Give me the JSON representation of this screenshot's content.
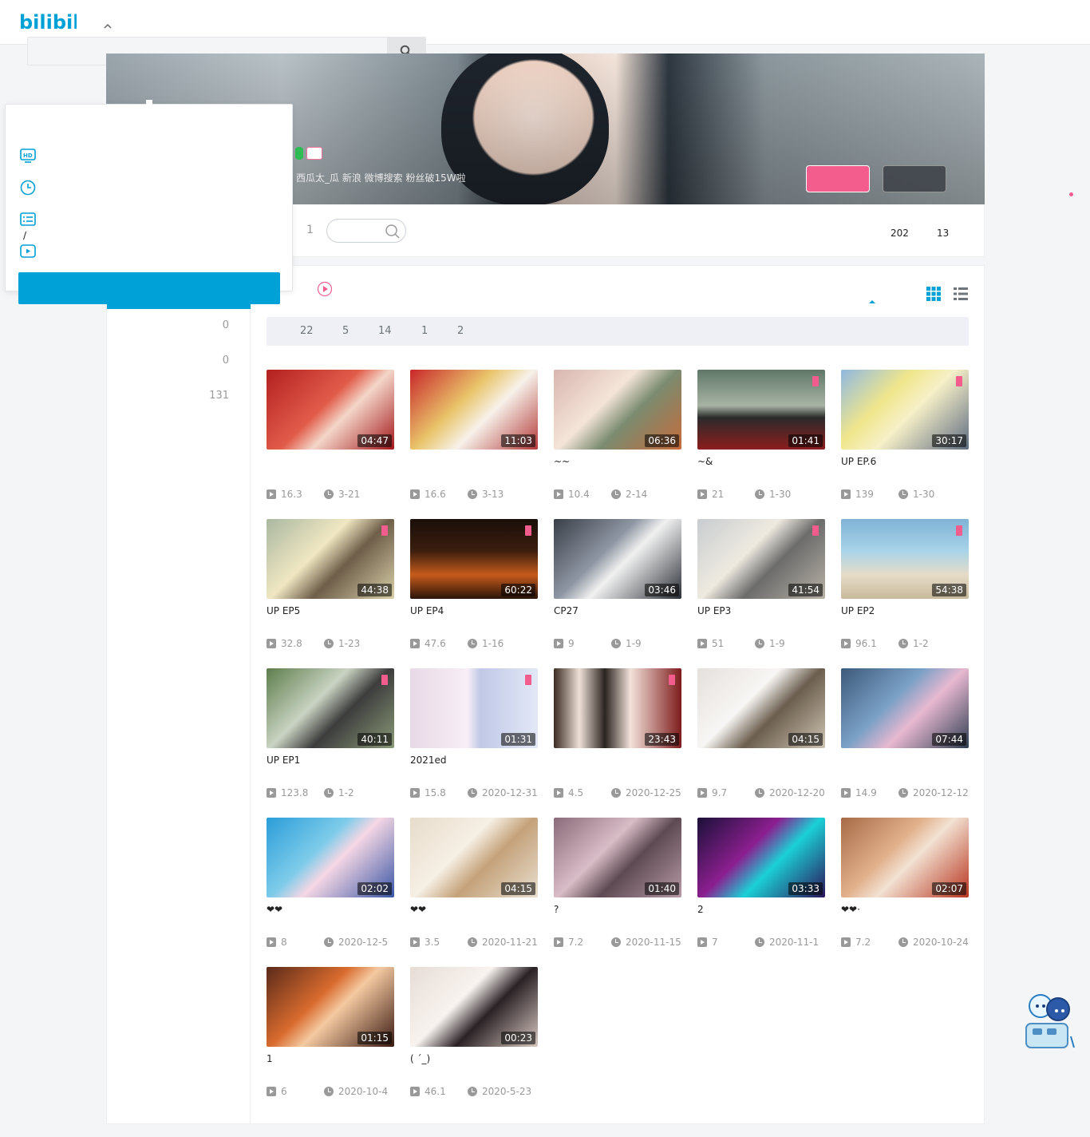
{
  "header": {
    "logo_text": "bilibili",
    "search_placeholder": ""
  },
  "banner": {
    "signature": "西瓜太_瓜 新浪 微博搜索 粉丝破15W啦",
    "follow_label": "",
    "message_label": ""
  },
  "nav": {
    "count": "1",
    "following": "202",
    "fans": "13"
  },
  "sidebar": {
    "counts": [
      "0",
      "0",
      "131"
    ]
  },
  "filters": {
    "counts": [
      "22",
      "5",
      "14",
      "1",
      "2"
    ]
  },
  "popup": {
    "slash": "/",
    "icons": [
      "hd-icon",
      "clock-icon",
      "list-icon",
      "video-icon"
    ]
  },
  "videos": [
    {
      "title": "",
      "duration": "04:47",
      "plays": "16.3",
      "date": "3-21",
      "pinned": false
    },
    {
      "title": "",
      "duration": "11:03",
      "plays": "16.6",
      "date": "3-13",
      "pinned": false
    },
    {
      "title": "~~",
      "duration": "06:36",
      "plays": "10.4",
      "date": "2-14",
      "pinned": false
    },
    {
      "title": "~&",
      "duration": "01:41",
      "plays": "21",
      "date": "1-30",
      "pinned": true
    },
    {
      "title": "UP EP.6",
      "duration": "30:17",
      "plays": "139",
      "date": "1-30",
      "pinned": true
    },
    {
      "title": "UP EP5",
      "duration": "44:38",
      "plays": "32.8",
      "date": "1-23",
      "pinned": true
    },
    {
      "title": "UP EP4",
      "duration": "60:22",
      "plays": "47.6",
      "date": "1-16",
      "pinned": true
    },
    {
      "title": "CP27",
      "duration": "03:46",
      "plays": "9",
      "date": "1-9",
      "pinned": false
    },
    {
      "title": "UP EP3",
      "duration": "41:54",
      "plays": "51",
      "date": "1-9",
      "pinned": true
    },
    {
      "title": "UP EP2",
      "duration": "54:38",
      "plays": "96.1",
      "date": "1-2",
      "pinned": true
    },
    {
      "title": "UP EP1",
      "duration": "40:11",
      "plays": "123.8",
      "date": "1-2",
      "pinned": true
    },
    {
      "title": "2021ed",
      "duration": "01:31",
      "plays": "15.8",
      "date": "2020-12-31",
      "pinned": true
    },
    {
      "title": "",
      "duration": "23:43",
      "plays": "4.5",
      "date": "2020-12-25",
      "pinned": true
    },
    {
      "title": "",
      "duration": "04:15",
      "plays": "9.7",
      "date": "2020-12-20",
      "pinned": false
    },
    {
      "title": "",
      "duration": "07:44",
      "plays": "14.9",
      "date": "2020-12-12",
      "pinned": false
    },
    {
      "title": "❤❤",
      "duration": "02:02",
      "plays": "8",
      "date": "2020-12-5",
      "pinned": false
    },
    {
      "title": "❤❤",
      "duration": "04:15",
      "plays": "3.5",
      "date": "2020-11-21",
      "pinned": false
    },
    {
      "title": "?",
      "duration": "01:40",
      "plays": "7.2",
      "date": "2020-11-15",
      "pinned": false
    },
    {
      "title": "2",
      "duration": "03:33",
      "plays": "7",
      "date": "2020-11-1",
      "pinned": false
    },
    {
      "title": "❤❤·",
      "duration": "02:07",
      "plays": "7.2",
      "date": "2020-10-24",
      "pinned": false
    },
    {
      "title": "1",
      "duration": "01:15",
      "plays": "6",
      "date": "2020-10-4",
      "pinned": false
    },
    {
      "title": "( ´_)",
      "duration": "00:23",
      "plays": "46.1",
      "date": "2020-5-23",
      "pinned": false
    }
  ],
  "colors": {
    "brand": "#00a1d6",
    "pink": "#f25d8e",
    "muted": "#999999"
  }
}
